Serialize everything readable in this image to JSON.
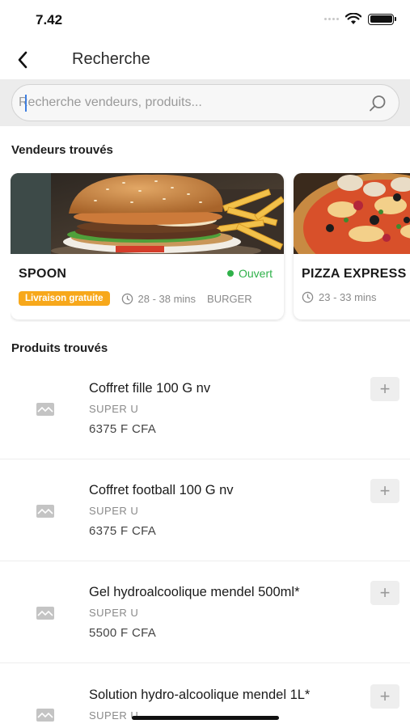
{
  "status_bar": {
    "time": "7.42"
  },
  "header": {
    "title": "Recherche"
  },
  "search": {
    "placeholder": "Recherche vendeurs, produits..."
  },
  "vendors_section": {
    "title": "Vendeurs trouvés",
    "vendors": [
      {
        "name": "SPOON",
        "status": "Ouvert",
        "badge": "Livraison gratuite",
        "time": "28 - 38 mins",
        "category": "BURGER"
      },
      {
        "name": "PIZZA EXPRESS",
        "time": "23 - 33 mins"
      }
    ]
  },
  "products_section": {
    "title": "Produits trouvés",
    "products": [
      {
        "name": "Coffret fille 100 G nv",
        "shop": "SUPER U",
        "price": "6375 F CFA"
      },
      {
        "name": "Coffret football 100 G nv",
        "shop": "SUPER U",
        "price": "6375 F CFA"
      },
      {
        "name": "Gel hydroalcoolique mendel 500ml*",
        "shop": "SUPER U",
        "price": "5500 F CFA"
      },
      {
        "name": "Solution hydro-alcoolique mendel 1L*",
        "shop": "SUPER U"
      }
    ],
    "add_label": "+"
  },
  "colors": {
    "open_status": "#2fb14a",
    "badge": "#f7a81b",
    "search_band": "#ececec"
  }
}
